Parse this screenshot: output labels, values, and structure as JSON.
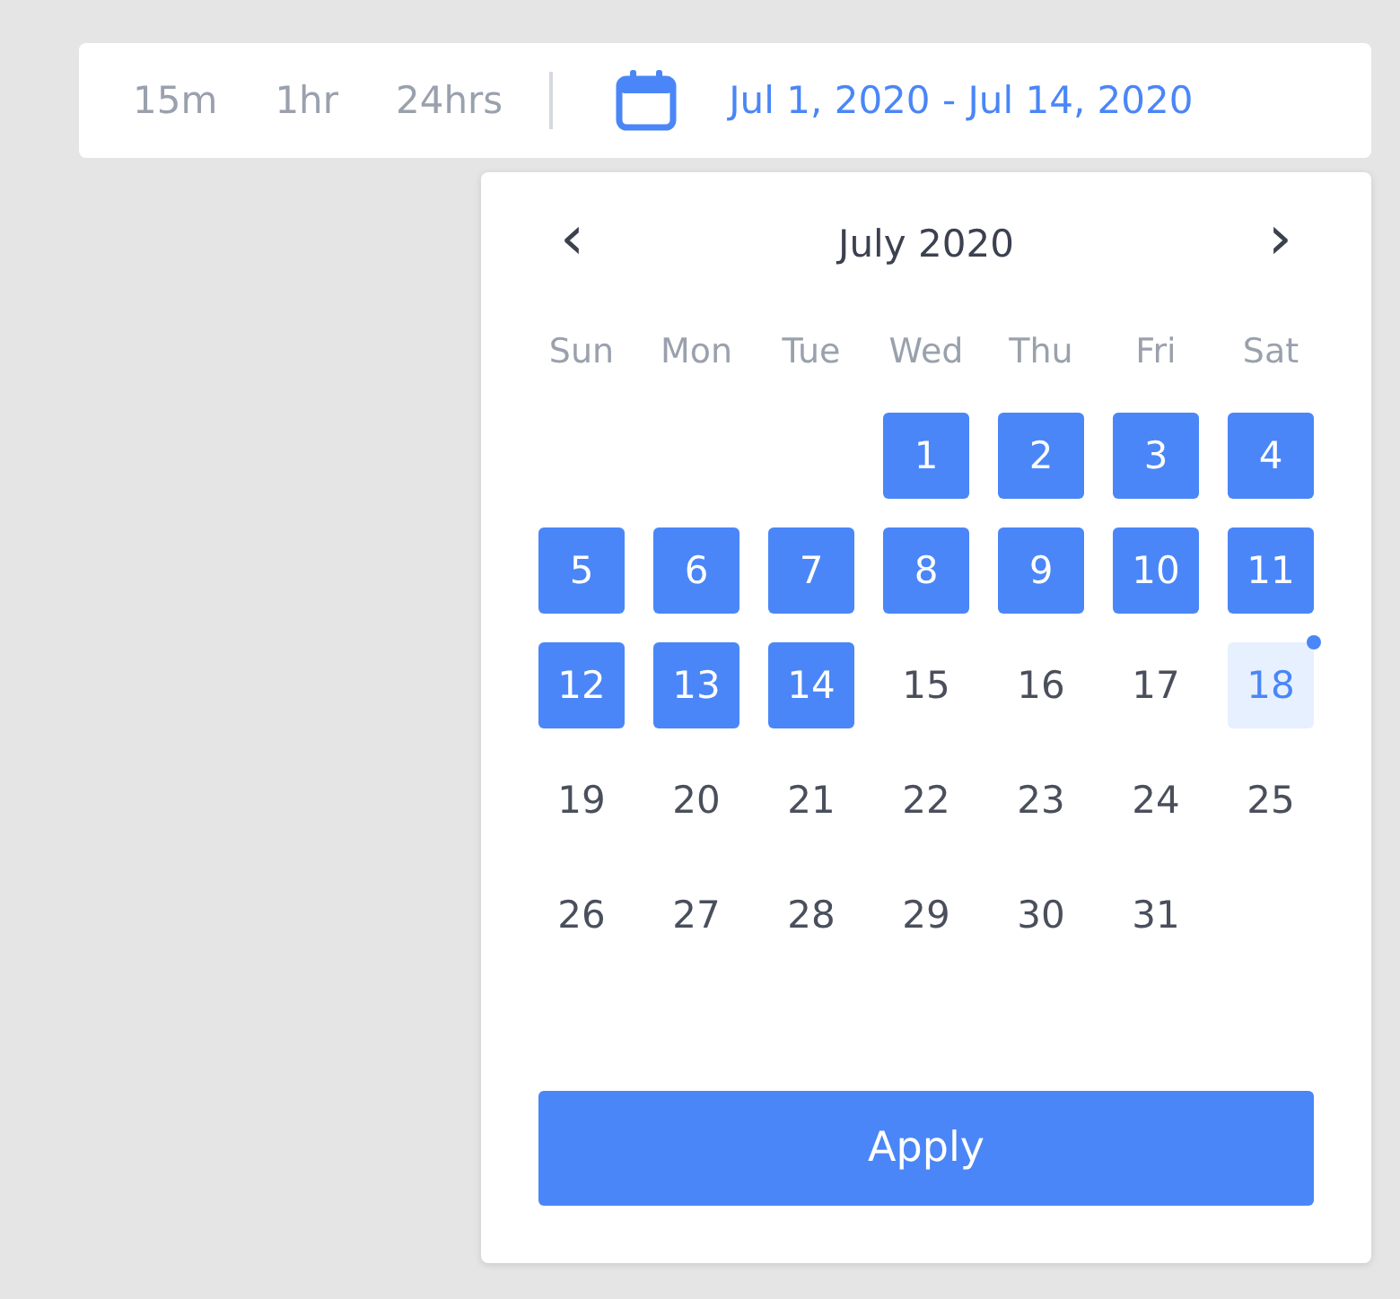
{
  "ranges": [
    {
      "label": "15m",
      "selected": false
    },
    {
      "label": "1hr",
      "selected": false
    },
    {
      "label": "24hrs",
      "selected": false
    }
  ],
  "date_range": "Jul 1, 2020 - Jul 14, 2020",
  "calendar": {
    "prev": "‹",
    "month": "July 2020",
    "next": "›",
    "weekdays": [
      "Sun",
      "Mon",
      "Tue",
      "Wed",
      "Thu",
      "Fri",
      "Sat"
    ],
    "days": [
      {
        "kind": "blank"
      },
      {
        "kind": "blank"
      },
      {
        "kind": "blank"
      },
      {
        "kind": "day",
        "day": "1",
        "selected": true,
        "today": false
      },
      {
        "kind": "day",
        "day": "2",
        "selected": true,
        "today": false
      },
      {
        "kind": "day",
        "day": "3",
        "selected": true,
        "today": false
      },
      {
        "kind": "day",
        "day": "4",
        "selected": true,
        "today": false
      },
      {
        "kind": "day",
        "day": "5",
        "selected": true,
        "today": false
      },
      {
        "kind": "day",
        "day": "6",
        "selected": true,
        "today": false
      },
      {
        "kind": "day",
        "day": "7",
        "selected": true,
        "today": false
      },
      {
        "kind": "day",
        "day": "8",
        "selected": true,
        "today": false
      },
      {
        "kind": "day",
        "day": "9",
        "selected": true,
        "today": false
      },
      {
        "kind": "day",
        "day": "10",
        "selected": true,
        "today": false
      },
      {
        "kind": "day",
        "day": "11",
        "selected": true,
        "today": false
      },
      {
        "kind": "day",
        "day": "12",
        "selected": true,
        "today": false
      },
      {
        "kind": "day",
        "day": "13",
        "selected": true,
        "today": false
      },
      {
        "kind": "day",
        "day": "14",
        "selected": true,
        "today": false
      },
      {
        "kind": "day",
        "day": "15",
        "selected": false,
        "today": false
      },
      {
        "kind": "day",
        "day": "16",
        "selected": false,
        "today": false
      },
      {
        "kind": "day",
        "day": "17",
        "selected": false,
        "today": false
      },
      {
        "kind": "day",
        "day": "18",
        "selected": false,
        "today": true
      },
      {
        "kind": "day",
        "day": "19",
        "selected": false,
        "today": false
      },
      {
        "kind": "day",
        "day": "20",
        "selected": false,
        "today": false
      },
      {
        "kind": "day",
        "day": "21",
        "selected": false,
        "today": false
      },
      {
        "kind": "day",
        "day": "22",
        "selected": false,
        "today": false
      },
      {
        "kind": "day",
        "day": "23",
        "selected": false,
        "today": false
      },
      {
        "kind": "day",
        "day": "24",
        "selected": false,
        "today": false
      },
      {
        "kind": "day",
        "day": "25",
        "selected": false,
        "today": false
      },
      {
        "kind": "day",
        "day": "26",
        "selected": false,
        "today": false
      },
      {
        "kind": "day",
        "day": "27",
        "selected": false,
        "today": false
      },
      {
        "kind": "day",
        "day": "28",
        "selected": false,
        "today": false
      },
      {
        "kind": "day",
        "day": "29",
        "selected": false,
        "today": false
      },
      {
        "kind": "day",
        "day": "30",
        "selected": false,
        "today": false
      },
      {
        "kind": "day",
        "day": "31",
        "selected": false,
        "today": false
      }
    ],
    "apply": "Apply"
  }
}
